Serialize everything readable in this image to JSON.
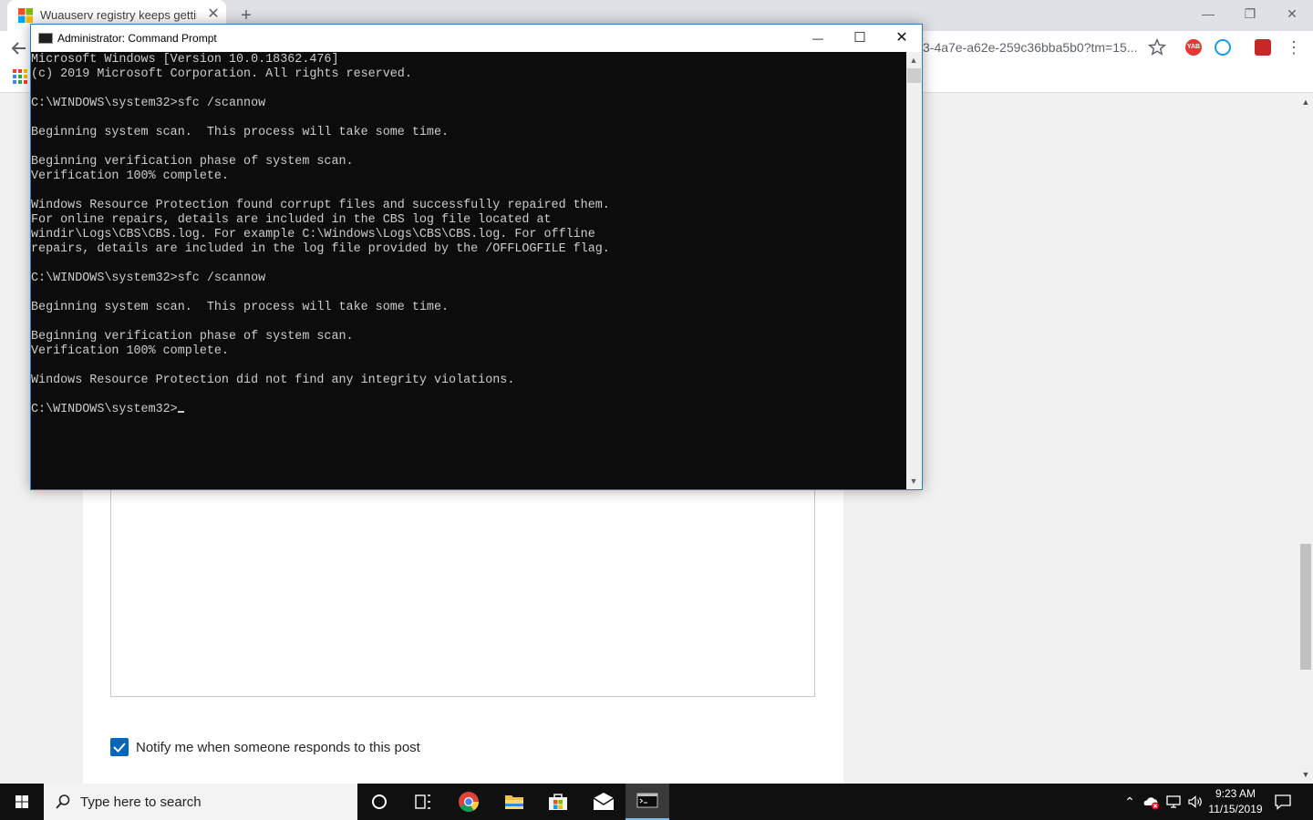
{
  "browser": {
    "tab_title": "Wuauserv registry keeps getting",
    "tab_close": "✕",
    "new_tab": "+",
    "window_controls": {
      "minimize": "—",
      "restore": "❐",
      "close": "✕"
    },
    "omnibox_url": "3-4a7e-a62e-259c36bba5b0?tm=15...",
    "extensions": {
      "yab_label": "YAB"
    },
    "menu_glyph": "⋮"
  },
  "page": {
    "notify_label": "Notify me when someone responds to this post",
    "notify_checked": true
  },
  "cmd": {
    "title": "Administrator: Command Prompt",
    "controls": {
      "minimize": "—",
      "maximize": "☐",
      "close": "✕"
    },
    "lines": [
      "Microsoft Windows [Version 10.0.18362.476]",
      "(c) 2019 Microsoft Corporation. All rights reserved.",
      "",
      "C:\\WINDOWS\\system32>sfc /scannow",
      "",
      "Beginning system scan.  This process will take some time.",
      "",
      "Beginning verification phase of system scan.",
      "Verification 100% complete.",
      "",
      "Windows Resource Protection found corrupt files and successfully repaired them.",
      "For online repairs, details are included in the CBS log file located at",
      "windir\\Logs\\CBS\\CBS.log. For example C:\\Windows\\Logs\\CBS\\CBS.log. For offline",
      "repairs, details are included in the log file provided by the /OFFLOGFILE flag.",
      "",
      "C:\\WINDOWS\\system32>sfc /scannow",
      "",
      "Beginning system scan.  This process will take some time.",
      "",
      "Beginning verification phase of system scan.",
      "Verification 100% complete.",
      "",
      "Windows Resource Protection did not find any integrity violations.",
      "",
      "C:\\WINDOWS\\system32>"
    ]
  },
  "taskbar": {
    "search_placeholder": "Type here to search",
    "clock_time": "9:23 AM",
    "clock_date": "11/15/2019",
    "apps": [
      "cortana-icon",
      "task-view-icon",
      "chrome-icon",
      "file-explorer-icon",
      "store-icon",
      "mail-icon",
      "command-prompt-icon"
    ]
  },
  "colors": {
    "accent": "#0067b8",
    "console_bg": "#0c0c0c",
    "console_fg": "#cccccc",
    "taskbar_bg": "#101010"
  }
}
